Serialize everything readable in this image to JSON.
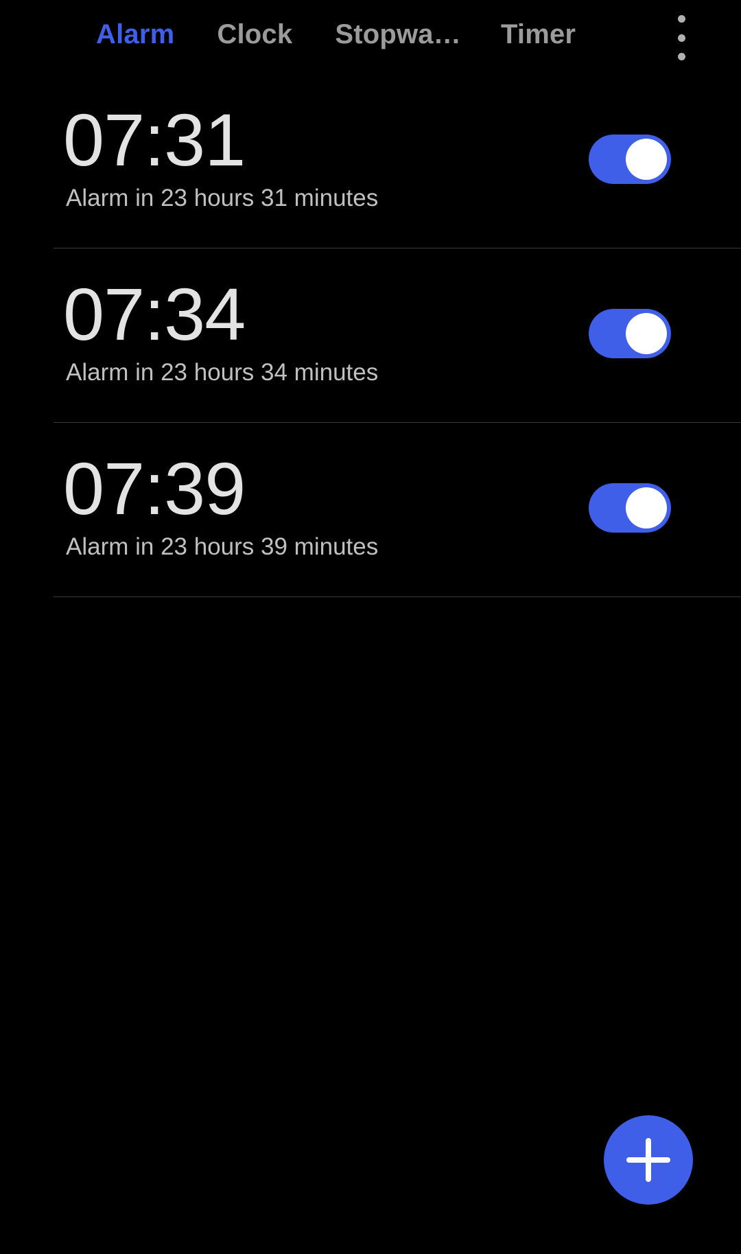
{
  "app": {
    "name": "Clock",
    "background_color": "#000000",
    "accent_color": "#3f5fe8"
  },
  "tabs": {
    "items": [
      {
        "label": "Alarm",
        "active": true
      },
      {
        "label": "Clock",
        "active": false
      },
      {
        "label": "Stopwa…",
        "active": false
      },
      {
        "label": "Timer",
        "active": false
      }
    ],
    "overflow_icon": "more-vertical-icon",
    "active_color": "#3f5fe8",
    "inactive_color": "#9b9b9b"
  },
  "alarms": [
    {
      "time": "07:31",
      "subtitle": "Alarm in 23 hours 31 minutes",
      "enabled": true,
      "toggle_state": "on"
    },
    {
      "time": "07:34",
      "subtitle": "Alarm in 23 hours 34 minutes",
      "enabled": true,
      "toggle_state": "on"
    },
    {
      "time": "07:39",
      "subtitle": "Alarm in 23 hours 39 minutes",
      "enabled": true,
      "toggle_state": "on"
    }
  ],
  "fab": {
    "icon": "plus-icon",
    "color": "#3f5fe8"
  }
}
